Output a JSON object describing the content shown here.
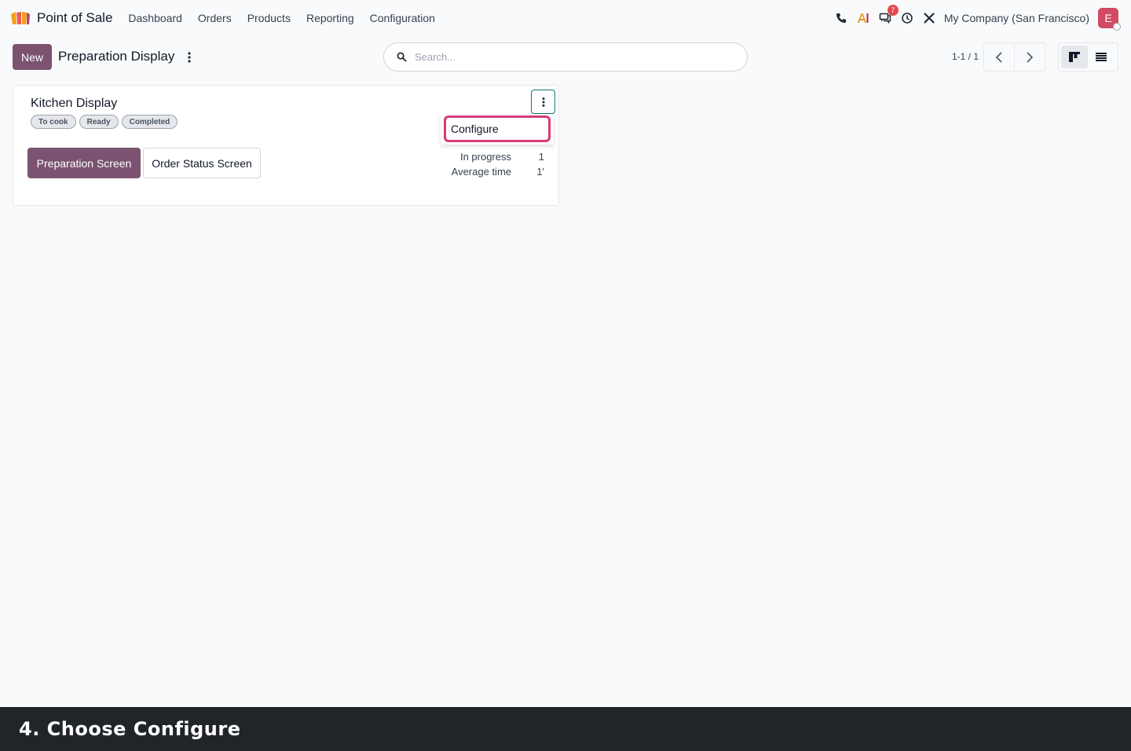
{
  "navbar": {
    "app_name": "Point of Sale",
    "menu": [
      "Dashboard",
      "Orders",
      "Products",
      "Reporting",
      "Configuration"
    ],
    "icons": [
      "phone-icon",
      "ai-icon",
      "chat-icon",
      "clock-icon",
      "tools-icon"
    ],
    "chat_badge": "7",
    "company": "My Company (San Francisco)",
    "avatar_initial": "E"
  },
  "control_panel": {
    "new_label": "New",
    "title": "Preparation Display",
    "search_placeholder": "Search...",
    "pager": "1-1 / 1"
  },
  "card": {
    "title": "Kitchen Display",
    "tags": [
      "To cook",
      "Ready",
      "Completed"
    ],
    "primary_button": "Preparation Screen",
    "secondary_button": "Order Status Screen",
    "stats": [
      {
        "label": "In progress",
        "value": "1"
      },
      {
        "label": "Average time",
        "value": "1'"
      }
    ],
    "dropdown_item": "Configure"
  },
  "caption": "4. Choose Configure",
  "colors": {
    "primary": "#7b5370",
    "highlight": "#d63a79",
    "caption_bg": "#212529",
    "badge": "#e5484d"
  }
}
